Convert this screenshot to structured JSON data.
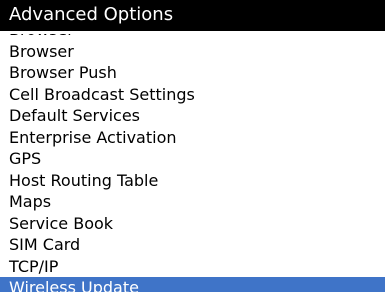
{
  "header": {
    "title": "Advanced Options"
  },
  "menu": {
    "items": [
      {
        "label": "Browser",
        "selected": false
      },
      {
        "label": "Browser",
        "selected": false
      },
      {
        "label": "Browser Push",
        "selected": false
      },
      {
        "label": "Cell Broadcast Settings",
        "selected": false
      },
      {
        "label": "Default Services",
        "selected": false
      },
      {
        "label": "Enterprise Activation",
        "selected": false
      },
      {
        "label": "GPS",
        "selected": false
      },
      {
        "label": "Host Routing Table",
        "selected": false
      },
      {
        "label": "Maps",
        "selected": false
      },
      {
        "label": "Service Book",
        "selected": false
      },
      {
        "label": "SIM Card",
        "selected": false
      },
      {
        "label": "TCP/IP",
        "selected": false
      },
      {
        "label": "Wireless Update",
        "selected": true
      }
    ]
  },
  "colors": {
    "title_background": "#000000",
    "title_text": "#ffffff",
    "selection_background": "#3f74c8",
    "selection_text": "#ffffff",
    "item_text": "#000000"
  }
}
